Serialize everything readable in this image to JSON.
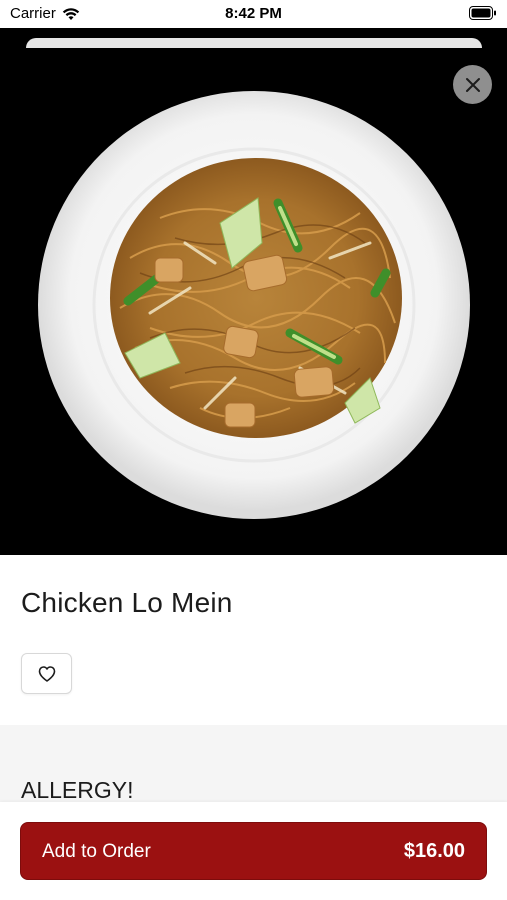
{
  "status_bar": {
    "carrier": "Carrier",
    "time": "8:42 PM"
  },
  "item": {
    "title": "Chicken Lo Mein",
    "image_icon": "noodle-plate-photo"
  },
  "sections": {
    "allergy_title": "ALLERGY!"
  },
  "order": {
    "add_label": "Add to Order",
    "price": "$16.00"
  },
  "colors": {
    "accent": "#9b1111",
    "hero_background": "#000000",
    "section_background": "#f5f5f5"
  },
  "icons": {
    "close": "close-icon",
    "favorite": "heart-icon",
    "wifi": "wifi-icon",
    "battery": "battery-icon"
  }
}
